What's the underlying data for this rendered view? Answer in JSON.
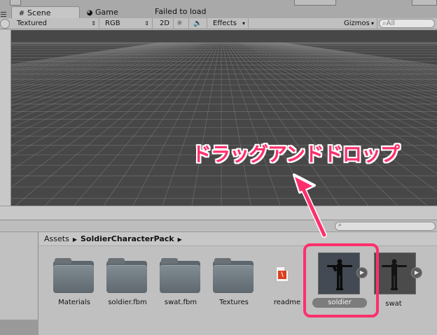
{
  "tabs": {
    "scene": {
      "label": "Scene",
      "icon": "hash-grid-icon"
    },
    "game": {
      "label": "Game",
      "icon": "pacman-icon"
    },
    "status": "Failed to load"
  },
  "scene_toolbar": {
    "shading_mode": "Textured",
    "render_mode": "RGB",
    "mode_2d": "2D",
    "lighting_icon": "sun-icon",
    "audio_icon": "speaker-icon",
    "effects": "Effects",
    "gizmos": "Gizmos",
    "search_placeholder": "All"
  },
  "project": {
    "breadcrumb": [
      "Assets",
      "SoldierCharacterPack"
    ],
    "items": [
      {
        "label": "Materials",
        "kind": "folder"
      },
      {
        "label": "soldier.fbm",
        "kind": "folder"
      },
      {
        "label": "swat.fbm",
        "kind": "folder"
      },
      {
        "label": "Textures",
        "kind": "folder"
      },
      {
        "label": "readme",
        "kind": "document"
      },
      {
        "label": "soldier",
        "kind": "prefab",
        "selected": true
      },
      {
        "label": "swat",
        "kind": "prefab"
      }
    ]
  },
  "annotation": {
    "text": "ドラッグアンドドロップ",
    "color": "#ff2f6c"
  },
  "colors": {
    "accent": "#ff2f6c",
    "scene_background": "#474747",
    "panel": "#c0c0c0"
  }
}
